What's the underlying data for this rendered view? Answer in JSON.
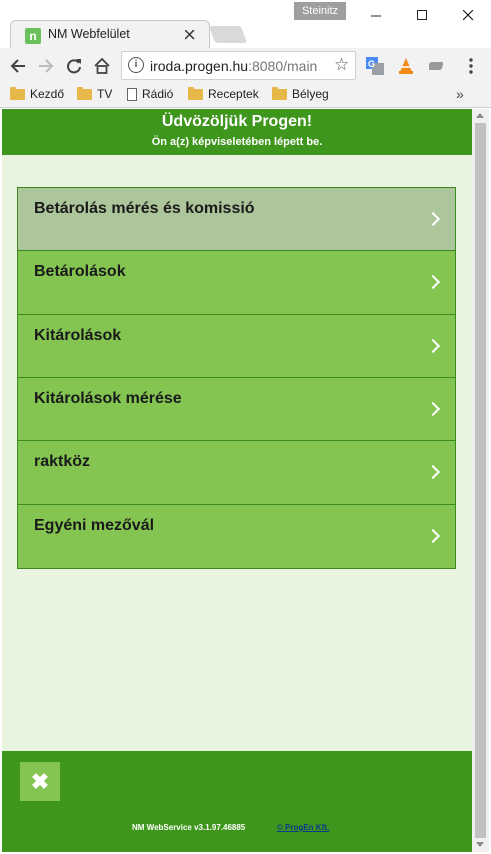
{
  "browser": {
    "profile_name": "Steinitz",
    "tab": {
      "title": "NM Webfelület",
      "favicon_letter": "n"
    },
    "address": {
      "host": "iroda.progen.hu",
      "rest": ":8080/main"
    },
    "bookmarks": [
      "Kezdő",
      "TV",
      "Rádió",
      "Receptek",
      "Bélyeg"
    ],
    "bookmarks_more": "»"
  },
  "page": {
    "header": {
      "title": "Üdvözöljük Progen!",
      "subtitle": "Ön a(z) képviseletében lépett be."
    },
    "menu": [
      {
        "label": "Betárolás mérés és komissió",
        "active": true
      },
      {
        "label": "Betárolások",
        "active": false
      },
      {
        "label": "Kitárolások",
        "active": false
      },
      {
        "label": "Kitárolások mérése",
        "active": false
      },
      {
        "label": "raktköz",
        "active": false
      },
      {
        "label": "Egyéni mezővál",
        "active": false
      }
    ],
    "footer": {
      "close_symbol": "✖",
      "version": "NM WebService v3.1.97.46885",
      "link": "© ProgEn Kft."
    }
  },
  "colors": {
    "header_green": "#3f961c",
    "menu_green": "#84c552",
    "menu_active": "#adc59a",
    "page_bg": "#e8f4e0"
  }
}
